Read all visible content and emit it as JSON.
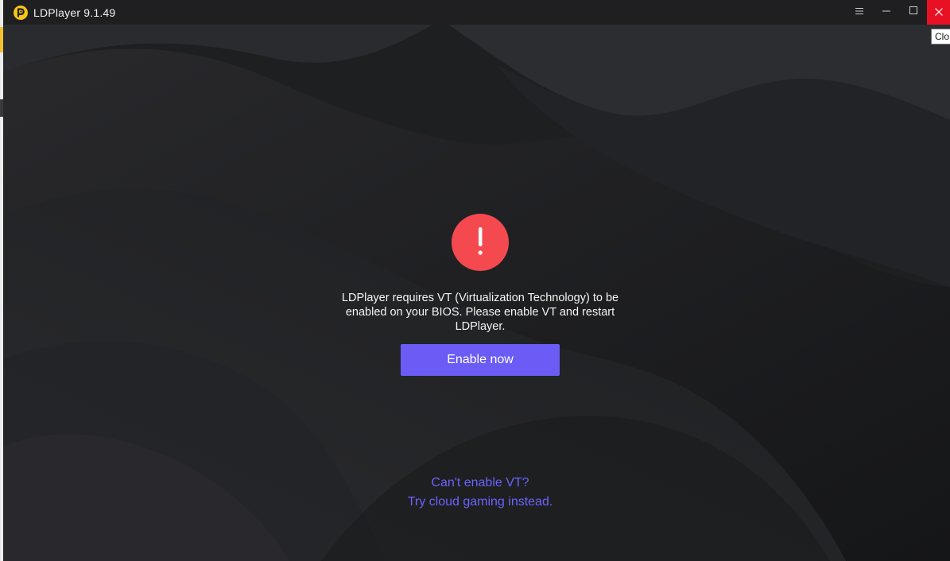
{
  "window": {
    "title": "LDPlayer 9.1.49",
    "controls": {
      "menu_icon": "menu-icon",
      "minimize_icon": "minimize-icon",
      "maximize_icon": "maximize-icon",
      "close_icon": "close-icon"
    },
    "tooltip": "Clo"
  },
  "dialog": {
    "alert_icon": "exclamation-icon",
    "message": "LDPlayer requires VT (Virtualization Technology) to be enabled on your BIOS. Please enable VT and restart LDPlayer.",
    "enable_button": "Enable now",
    "cant_enable_link": "Can't enable VT?",
    "cloud_link": "Try cloud gaming instead."
  },
  "colors": {
    "background": "#1f2022",
    "accent": "#6b5cf6",
    "link": "#6c63ff",
    "alert": "#f44a4f",
    "close_hover": "#e81123",
    "logo": "#f5c518"
  }
}
